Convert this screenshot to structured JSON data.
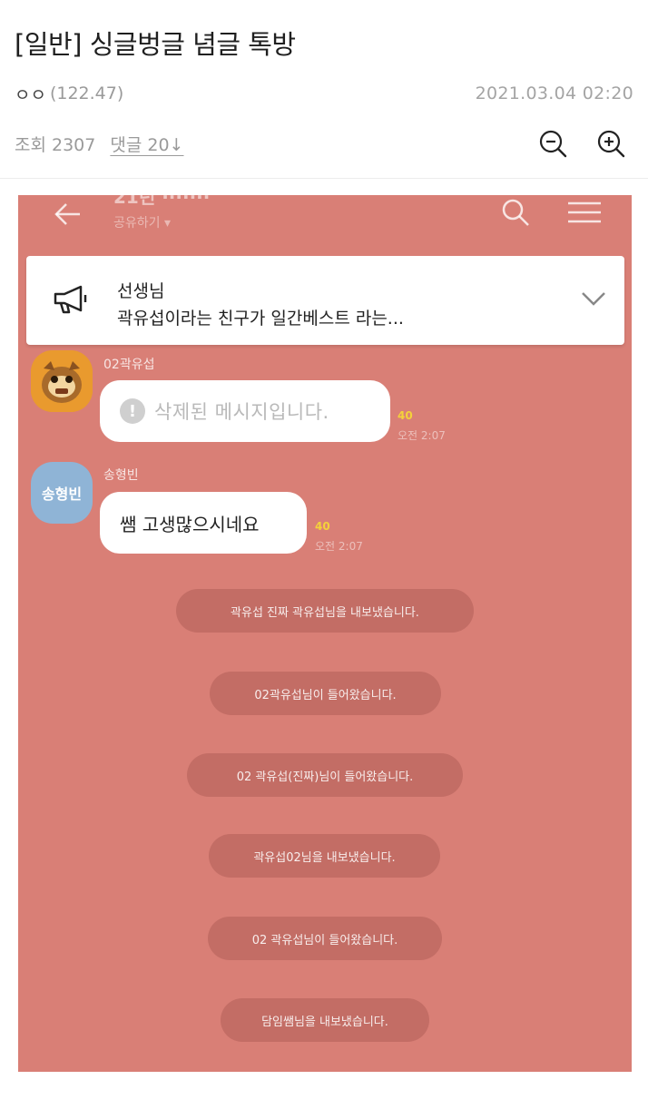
{
  "post": {
    "title": "[일반] 싱글벙글 념글 톡방",
    "author": "ㅇㅇ",
    "author_ip": "(122.47)",
    "date": "2021.03.04 02:20",
    "views": "조회 2307",
    "comments": "댓글 20↓"
  },
  "chat": {
    "notice_title": "선생님",
    "notice_body": "곽유섭이라는 친구가 일간베스트 라는...",
    "messages": [
      {
        "sender": "02곽유섭",
        "text": "삭제된 메시지입니다.",
        "deleted_icon": "!",
        "unread": "40",
        "time": "오전 2:07"
      },
      {
        "sender": "송형빈",
        "avatar_text": "송형빈",
        "text": "쌤 고생많으시네요",
        "unread": "40",
        "time": "오전 2:07"
      }
    ],
    "system_messages": [
      "곽유섭 진짜 곽유섭님을 내보냈습니다.",
      "02곽유섭님이 들어왔습니다.",
      "02 곽유섭(진짜)님이 들어왔습니다.",
      "곽유섭02님을 내보냈습니다.",
      "02 곽유섭님이 들어왔습니다.",
      "담임쌤님을 내보냈습니다."
    ]
  },
  "icons": {
    "zoom_out": "zoom-out-icon",
    "zoom_in": "zoom-in-icon",
    "back": "back-arrow-icon",
    "search": "search-icon",
    "menu": "menu-icon",
    "notice": "megaphone-icon",
    "expand": "chevron-down-icon"
  },
  "colors": {
    "chat_background": "#d97f76",
    "unread_count": "#f4d23a"
  }
}
